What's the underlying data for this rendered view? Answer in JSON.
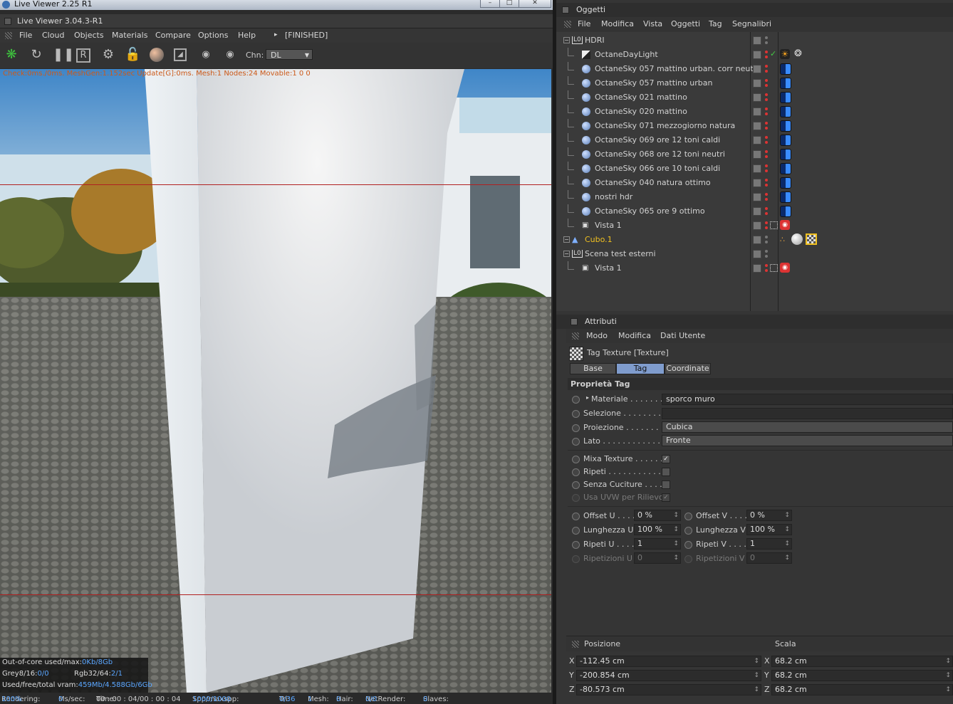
{
  "live_viewer": {
    "window_title": "Live Viewer 2.25 R1",
    "window_buttons": [
      "–",
      "□",
      "✕"
    ],
    "subtitle": "Live Viewer 3.04.3-R1",
    "menu": [
      "File",
      "Cloud",
      "Objects",
      "Materials",
      "Compare",
      "Options",
      "Help"
    ],
    "state": "[FINISHED]",
    "toolbar_icons": [
      "octane-logo-icon",
      "refresh-icon",
      "pause-icon",
      "region-render-icon",
      "settings-gear-icon",
      "lock-icon",
      "material-sphere-icon",
      "focus-picker-icon",
      "pin-f-icon",
      "pin-m-icon"
    ],
    "chn_label": "Chn:",
    "chn_value": "DL",
    "render_info": "Check:0ms./0ms. MeshGen:1.152sec Update[G]:0ms. Mesh:1 Nodes:24 Movable:1  0 0",
    "ooc": {
      "line1_label": "Out-of-core used/max:",
      "line1_value": "0Kb/8Gb",
      "grey_label": "Grey8/16:",
      "grey_value": "0/0",
      "rgb_label": "Rgb32/64:",
      "rgb_value": "2/1",
      "vram_label": "Used/free/total vram:",
      "vram_value": "459Mb/4.588Gb/6Gb"
    },
    "status": {
      "rendering_label": "Rendering:",
      "rendering_value": "100%",
      "ms_label": "Ms/sec:",
      "ms_value": "0",
      "time_label": "Time:",
      "time_value": "00 : 00 : 04/00 : 00 : 04",
      "spp_label": "Spp/maxspp:",
      "spp_value": "1000/1000",
      "tri_label": "Tri:",
      "tri_value": "0/36",
      "mesh_label": "Mesh:",
      "mesh_value": "1",
      "hair_label": "Hair:",
      "hair_value": "0",
      "net_label": "NetRender:",
      "net_value": "0/0",
      "slaves_label": "Slaves:",
      "slaves_value": "0"
    }
  },
  "objects_panel": {
    "title": "Oggetti",
    "menu": [
      "File",
      "Modifica",
      "Vista",
      "Oggetti",
      "Tag",
      "Segnalibri"
    ],
    "rows": [
      {
        "name": "HDRI",
        "type": "null",
        "indent": 0,
        "tag": ""
      },
      {
        "name": "OctaneDayLight",
        "type": "light",
        "indent": 1,
        "tag": "sun"
      },
      {
        "name": "OctaneSky 057 mattino urban. corr neutra",
        "type": "sky",
        "indent": 1,
        "tag": "env"
      },
      {
        "name": "OctaneSky 057 mattino urban",
        "type": "sky",
        "indent": 1,
        "tag": "env"
      },
      {
        "name": "OctaneSky 021 mattino",
        "type": "sky",
        "indent": 1,
        "tag": "env"
      },
      {
        "name": "OctaneSky 020 mattino",
        "type": "sky",
        "indent": 1,
        "tag": "env"
      },
      {
        "name": "OctaneSky 071 mezzogiorno natura",
        "type": "sky",
        "indent": 1,
        "tag": "env"
      },
      {
        "name": "OctaneSky 069 ore 12 toni caldi",
        "type": "sky",
        "indent": 1,
        "tag": "env"
      },
      {
        "name": "OctaneSky 068 ore 12 toni neutri",
        "type": "sky",
        "indent": 1,
        "tag": "env"
      },
      {
        "name": "OctaneSky 066 ore 10 toni caldi",
        "type": "sky",
        "indent": 1,
        "tag": "env"
      },
      {
        "name": "OctaneSky 040 natura ottimo",
        "type": "sky",
        "indent": 1,
        "tag": "env"
      },
      {
        "name": "nostri hdr",
        "type": "sky",
        "indent": 1,
        "tag": "env"
      },
      {
        "name": "OctaneSky 065 ore 9 ottimo",
        "type": "sky",
        "indent": 1,
        "tag": "env"
      },
      {
        "name": "Vista 1",
        "type": "camera",
        "indent": 1,
        "tag": "cam"
      },
      {
        "name": "Cubo.1",
        "type": "cube",
        "indent": 0,
        "tag": "tex"
      },
      {
        "name": "Scena test esterni",
        "type": "null",
        "indent": 0,
        "tag": ""
      },
      {
        "name": "Vista 1",
        "type": "camera",
        "indent": 1,
        "tag": "cam"
      }
    ]
  },
  "attributes_panel": {
    "title": "Attributi",
    "menu": [
      "Modo",
      "Modifica",
      "Dati Utente"
    ],
    "object_title": "Tag Texture [Texture]",
    "tabs": [
      "Base",
      "Tag",
      "Coordinate"
    ],
    "active_tab": "Tag",
    "section_title": "Proprietà Tag",
    "materiale_label": "Materiale . . . . . . .",
    "materiale_value": "sporco muro",
    "selezione_label": "Selezione . . . . . . . . .",
    "selezione_value": "",
    "proiezione_label": "Proiezione . . . . . . . . .",
    "proiezione_value": "Cubica",
    "lato_label": "Lato . . . . . . . . . . . . .",
    "lato_value": "Fronte",
    "mixa_label": "Mixa Texture . . . . . .",
    "mixa_checked": true,
    "ripeti_label": "Ripeti . . . . . . . . . . . .",
    "ripeti_checked": false,
    "senza_label": "Senza Cuciture . . . . .",
    "senza_checked": false,
    "uvw_label": "Usa UVW per Rilievo",
    "uvw_checked": true,
    "offset_u_label": "Offset U . . . .",
    "offset_u_value": "0 %",
    "offset_v_label": "Offset V . . . .",
    "offset_v_value": "0 %",
    "lung_u_label": "Lunghezza U",
    "lung_u_value": "100 %",
    "lung_v_label": "Lunghezza V",
    "lung_v_value": "100 %",
    "rip_u_label": "Ripeti U . . . .",
    "rip_u_value": "1",
    "rip_v_label": "Ripeti V . . . .",
    "rip_v_value": "1",
    "ripz_u_label": "Ripetizioni U",
    "ripz_u_value": "0",
    "ripz_v_label": "Ripetizioni V",
    "ripz_v_value": "0"
  },
  "coords_panel": {
    "pos_title": "Posizione",
    "scale_title": "Scala",
    "pos": [
      {
        "axis": "X",
        "value": "-112.45 cm"
      },
      {
        "axis": "Y",
        "value": "-200.854 cm"
      },
      {
        "axis": "Z",
        "value": "-80.573 cm"
      }
    ],
    "scale": [
      {
        "axis": "X",
        "value": "68.2 cm"
      },
      {
        "axis": "Y",
        "value": "68.2 cm"
      },
      {
        "axis": "Z",
        "value": "68.2 cm"
      }
    ]
  },
  "colors": {
    "accent": "#7f9ccd",
    "cube_name": "#f0c020",
    "render_info": "#cc5a1a",
    "vram": "#5aa6ff"
  }
}
